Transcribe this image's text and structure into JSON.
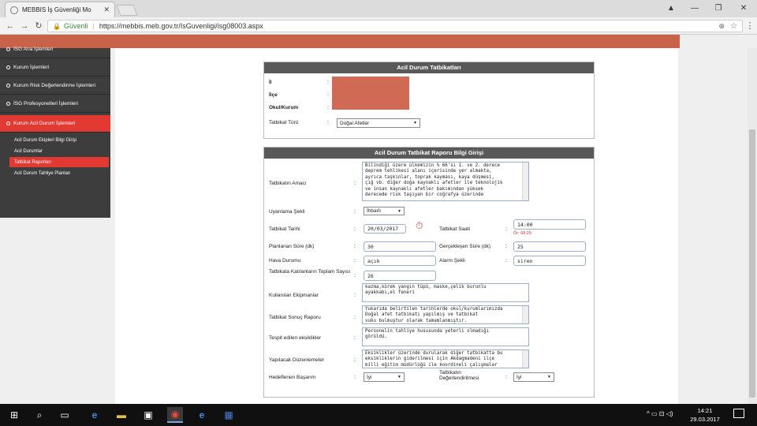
{
  "browser": {
    "tab_title": "MEBBIS İş Güvenliği Mo",
    "security_label": "Güvenli",
    "url": "https://mebbis.meb.gov.tr/IsGuvenligi/isg08003.aspx"
  },
  "sidebar": {
    "items": [
      {
        "label": "İSG Ana İşlemleri"
      },
      {
        "label": "Kurum İşlemleri"
      },
      {
        "label": "Kurum Risk Değerlendirme İşlemleri"
      },
      {
        "label": "İSG Profesyonelleri İşlemleri"
      },
      {
        "label": "Kurum Acil Durum İşlemleri"
      }
    ],
    "subitems": [
      {
        "label": "Acil Durum Ekipleri Bilgi Girişi"
      },
      {
        "label": "Acil Durumlar"
      },
      {
        "label": "Tatbikat Raporları"
      },
      {
        "label": "Acil Durum Tahliye Planları"
      }
    ]
  },
  "panel1": {
    "title": "Acil Durum Tatbikatları",
    "il_label": "İl",
    "ilce_label": "İlçe",
    "okul_label": "Okul/Kurum",
    "tur_label": "Tatbikat Türü",
    "tur_value": "Doğal Afetler"
  },
  "panel2": {
    "title": "Acil Durum Tatbikat Raporu Bilgi Girişi",
    "amac_label": "Tatbikatın Amacı",
    "amac_value": "Bilindiği üzere ülkemizin % 66'sı 1. ve 2. derece\ndeprem tehlikesi alanı içerisinde yer almakta,\nayrıca taşkınlar, toprak kayması, kaya düşmesi,\nçığ vb. diğer doğa kaynaklı afetler ile teknolojik\nve insan kaynaklı afetler bakımından yüksek\nderecede risk taşıyan bir coğrafya üzerinde",
    "uyarma_label": "Uyarılama Şekli",
    "uyarma_value": "İhbarlı",
    "tarih_label": "Tatbikat Tarihi",
    "tarih_value": "20/03/2017",
    "saat_label": "Tatbikat Saati",
    "saat_value": "14:00",
    "saat_note": "Ör: 08:25",
    "planlanan_label": "Planlanan Süre (dk)",
    "planlanan_value": "30",
    "gercek_label": "Gerçekleşen Süre (dk)",
    "gercek_value": "25",
    "hava_label": "Hava Durumu",
    "hava_value": "açık",
    "alarm_label": "Alarm Şekli",
    "alarm_value": "siren",
    "katilan_label": "Tatbikata Katılanların Toplam Sayısı",
    "katilan_value": "26",
    "ekipman_label": "Kullanılan Ekipmanlar",
    "ekipman_value": "kazma,kürek yangın tüpü, maske,çelik burunlu\nayakkabı,el feneri",
    "sonuc_label": "Tatbikat Sonuç Raporu",
    "sonuc_value": "Yukarıda belirtilen tarihlerde okul/kurumlarımızda\nDoğal afet tatbikatı yapılmış ve tatbikat\nvuku bulmuştur olarak tamamlanmıştır.",
    "eksik_label": "Tespit edilen eksiklikler",
    "eksik_value": "Personelin tahliye hususunda yeterli olmadığı\ngörüldü.",
    "duzen_label": "Yapılacak Düzenlemeler",
    "duzen_value": "Eksiklikler üzerinde durularak diğer tatbikatta bu\neksikliklerin giderilmesi için Akdagmadeni ilçe\nmilli eğitim müdürlüğü ile koordineli çalışmalar",
    "basari_label": "Hedeflenen Başarım",
    "basari_value": "İyi",
    "deger_label": "Tatbikatın Değerlendirilmesi",
    "deger_value": "İyi"
  },
  "taskbar": {
    "time": "14:21",
    "date": "29.03.2017"
  }
}
